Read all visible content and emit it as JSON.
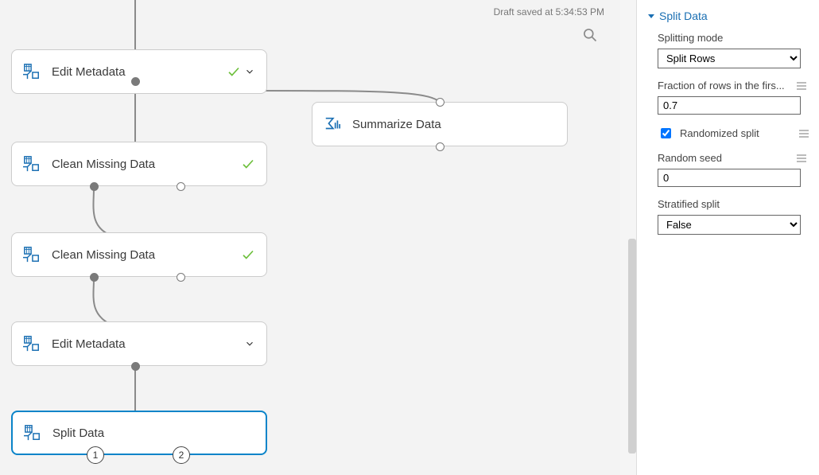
{
  "status": {
    "draft_saved": "Draft saved at 5:34:53 PM"
  },
  "modules": {
    "edit_meta_1": "Edit Metadata",
    "clean_1": "Clean Missing Data",
    "clean_2": "Clean Missing Data",
    "edit_meta_2": "Edit Metadata",
    "split": "Split Data",
    "summarize": "Summarize Data"
  },
  "output_ports": {
    "p1": "1",
    "p2": "2"
  },
  "panel": {
    "title": "Split Data",
    "splitting_mode_label": "Splitting mode",
    "splitting_mode_value": "Split Rows",
    "fraction_label": "Fraction of rows in the firs...",
    "fraction_value": "0.7",
    "randomized_label": "Randomized split",
    "randomized_checked": true,
    "seed_label": "Random seed",
    "seed_value": "0",
    "stratified_label": "Stratified split",
    "stratified_value": "False"
  }
}
